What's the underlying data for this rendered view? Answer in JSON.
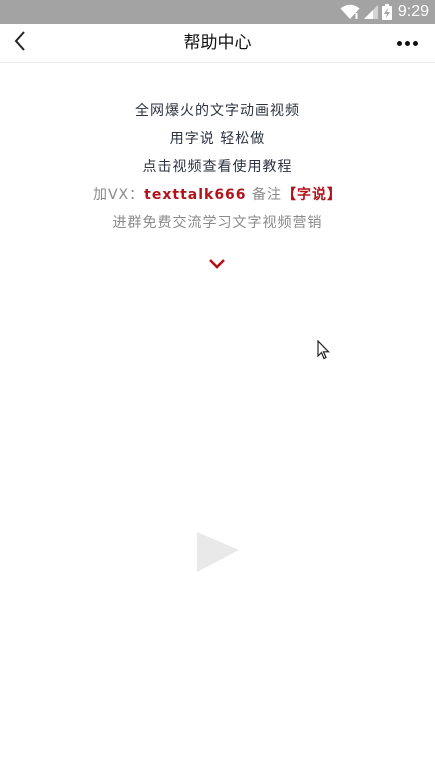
{
  "status_bar": {
    "time": "9:29",
    "wifi_icon": "wifi-icon",
    "signal_icon": "signal-icon",
    "battery_icon": "battery-charging-icon"
  },
  "nav": {
    "title": "帮助中心",
    "back_icon": "chevron-left-icon",
    "more_icon": "more-dots-icon"
  },
  "intro": {
    "line1": "全网爆火的文字动画视频",
    "line2": "用字说 轻松做",
    "line3": "点击视频查看使用教程",
    "vx_label": "加VX：",
    "vx_id": "texttalk666",
    "vx_note_label": " 备注",
    "vx_note": "【字说】",
    "line5": "进群免费交流学习文字视频营销"
  },
  "icons": {
    "scroll_hint": "chevron-down-icon",
    "play": "play-icon"
  },
  "colors": {
    "status_bar_bg": "#a3a3a3",
    "accent_red": "#b3121b",
    "text_dark": "#2d3340",
    "text_muted": "#8a8a8a"
  }
}
